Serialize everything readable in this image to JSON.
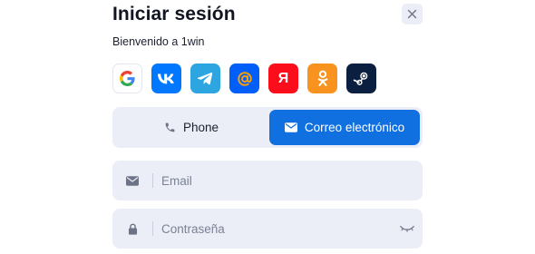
{
  "header": {
    "title": "Iniciar sesión",
    "subtitle": "Bienvenido a 1win"
  },
  "social_logins": [
    {
      "name": "Google",
      "icon": "google-icon",
      "color": "#ffffff"
    },
    {
      "name": "VK",
      "icon": "vk-icon",
      "color": "#0077ff"
    },
    {
      "name": "Telegram",
      "icon": "telegram-icon",
      "color": "#2ca5e0"
    },
    {
      "name": "Mail.ru",
      "icon": "at-sign-icon",
      "color": "#005ff9"
    },
    {
      "name": "Yandex",
      "icon": "yandex-icon",
      "color": "#fc0d1b",
      "glyph": "Я"
    },
    {
      "name": "Odnoklassniki",
      "icon": "ok-icon",
      "color": "#f7931e"
    },
    {
      "name": "Steam",
      "icon": "steam-icon",
      "color": "#0b1f40"
    }
  ],
  "tabs": {
    "phone_label": "Phone",
    "email_label": "Correo electrónico",
    "active": "email",
    "active_color": "#1070e0"
  },
  "form": {
    "email_placeholder": "Email",
    "password_placeholder": "Contraseña"
  }
}
